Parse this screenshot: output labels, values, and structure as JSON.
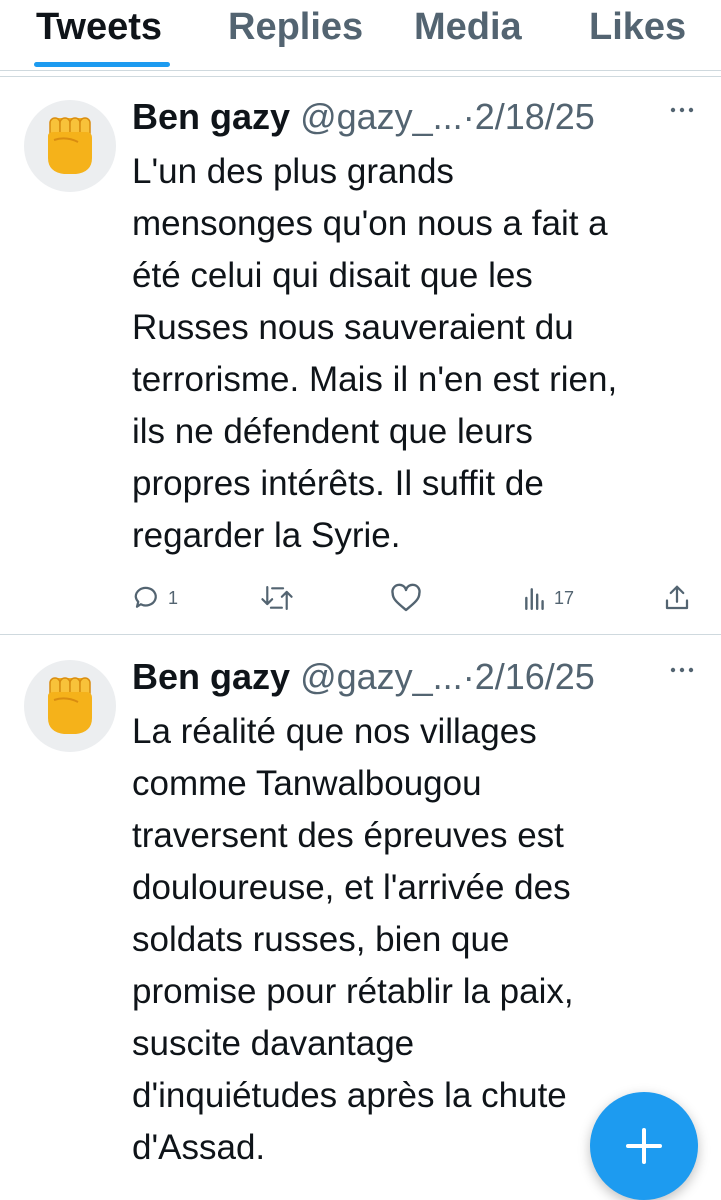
{
  "tabs": [
    {
      "label": "Tweets",
      "active": true
    },
    {
      "label": "Replies",
      "active": false
    },
    {
      "label": "Media",
      "active": false
    },
    {
      "label": "Likes",
      "active": false
    }
  ],
  "tweets": [
    {
      "avatar_icon": "raised-fist-emoji",
      "name": "Ben gazy",
      "handle": "@gazy_...",
      "separator": "·",
      "date": "2/18/25",
      "more_icon": "more-dots-icon",
      "text": "L'un des plus grands\nmensonges qu'on nous a fait a\nété celui qui disait que les\nRusses nous sauveraient du\nterrorisme. Mais il n'en est rien,\nils ne défendent que leurs\npropres intérêts. Il suffit de\nregarder la Syrie.",
      "replies": "1",
      "retweets": "",
      "likes": "",
      "views": "17"
    },
    {
      "avatar_icon": "raised-fist-emoji",
      "name": "Ben gazy",
      "handle": "@gazy_...",
      "separator": "·",
      "date": "2/16/25",
      "more_icon": "more-dots-icon",
      "text": "La réalité que nos villages\ncomme Tanwalbougou\ntraversent des épreuves est\ndouloureuse, et l'arrivée des\nsoldats russes, bien que\npromise pour rétablir la paix,\nsuscite davantage\nd'inquiétudes après la chute\nd'Assad."
    }
  ],
  "fab": {
    "icon": "plus-icon"
  },
  "colors": {
    "accent": "#1d9bf0",
    "text": "#0f1419",
    "muted": "#536471",
    "divider": "#cfd9de"
  }
}
